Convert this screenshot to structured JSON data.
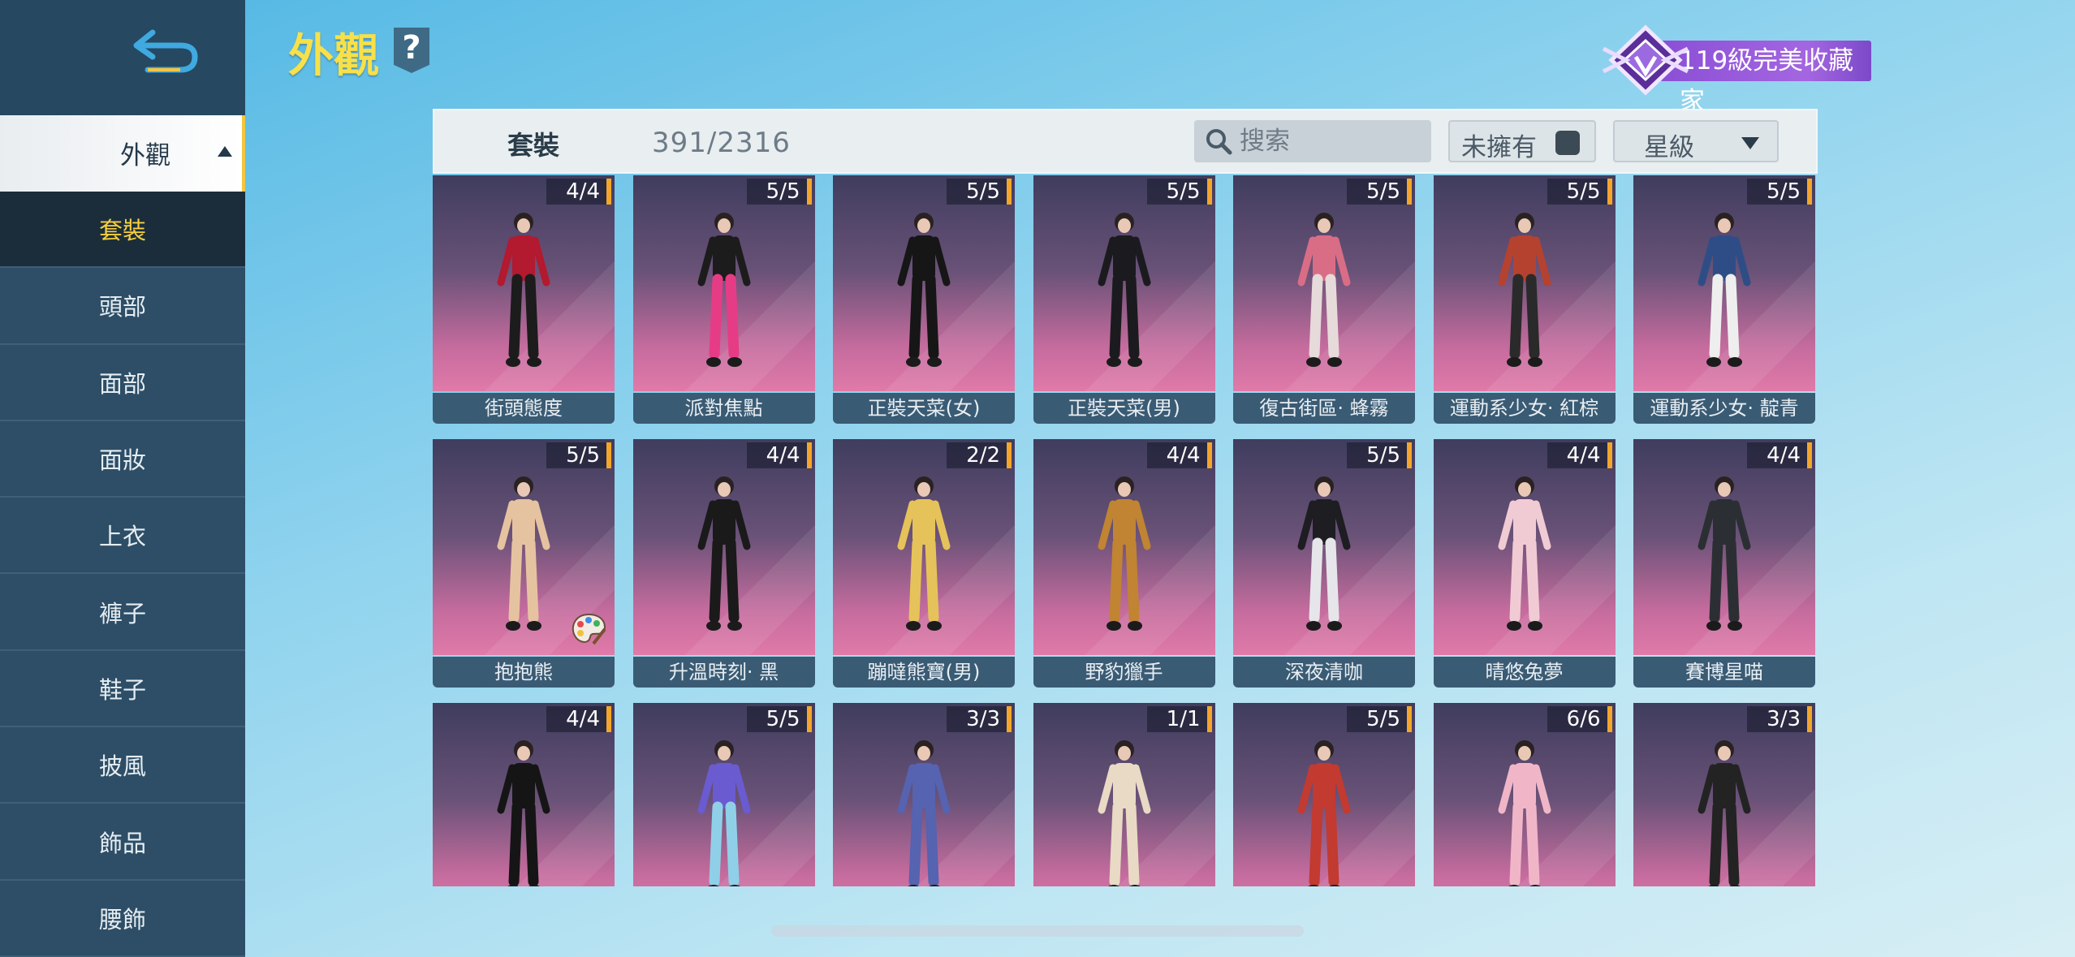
{
  "title": "外觀",
  "help_glyph": "?",
  "rank_badge": "119級完美收藏家",
  "sidebar": {
    "category": "外觀",
    "items": [
      {
        "label": "套裝",
        "active": true
      },
      {
        "label": "頭部"
      },
      {
        "label": "面部"
      },
      {
        "label": "面妝"
      },
      {
        "label": "上衣"
      },
      {
        "label": "褲子"
      },
      {
        "label": "鞋子"
      },
      {
        "label": "披風"
      },
      {
        "label": "飾品"
      },
      {
        "label": "腰飾"
      }
    ]
  },
  "filter_bar": {
    "tab_label": "套裝",
    "count": "391/2316",
    "search_placeholder": "搜索",
    "owned_filter": "未擁有",
    "sort_label": "星級"
  },
  "outfits": [
    {
      "name": "街頭態度",
      "count": "4/4",
      "colors": [
        "#b3192f",
        "#1c1c1c"
      ]
    },
    {
      "name": "派對焦點",
      "count": "5/5",
      "colors": [
        "#1c1c1c",
        "#e63c86"
      ]
    },
    {
      "name": "正裝天菜(女)",
      "count": "5/5",
      "colors": [
        "#161616",
        "#161616"
      ]
    },
    {
      "name": "正裝天菜(男)",
      "count": "5/5",
      "colors": [
        "#1b1b1f",
        "#1b1b1f"
      ]
    },
    {
      "name": "復古街區· 蜂霧",
      "count": "5/5",
      "colors": [
        "#d96d86",
        "#e7dada"
      ]
    },
    {
      "name": "運動系少女· 紅棕",
      "count": "5/5",
      "colors": [
        "#b5422f",
        "#2a2a2a"
      ]
    },
    {
      "name": "運動系少女· 靛青",
      "count": "5/5",
      "colors": [
        "#2e4d86",
        "#eeeeee"
      ]
    },
    {
      "name": "抱抱熊",
      "count": "5/5",
      "colors": [
        "#e6c3a0",
        "#e6c3a0"
      ],
      "palette": true
    },
    {
      "name": "升溫時刻· 黑",
      "count": "4/4",
      "colors": [
        "#1a1a1a",
        "#1a1a1a"
      ]
    },
    {
      "name": "蹦噠熊寶(男)",
      "count": "2/2",
      "colors": [
        "#e5c35a",
        "#e5c35a"
      ]
    },
    {
      "name": "野豹獵手",
      "count": "4/4",
      "colors": [
        "#c08432",
        "#c08432"
      ]
    },
    {
      "name": "深夜清咖",
      "count": "5/5",
      "colors": [
        "#1d1d22",
        "#e6e6ea"
      ]
    },
    {
      "name": "晴悠兔夢",
      "count": "4/4",
      "colors": [
        "#f1cbd4",
        "#f1cbd4"
      ]
    },
    {
      "name": "賽博星喵",
      "count": "4/4",
      "colors": [
        "#2b2f33",
        "#2b2f33"
      ]
    },
    {
      "name": "",
      "count": "4/4",
      "colors": [
        "#151515",
        "#151515"
      ]
    },
    {
      "name": "",
      "count": "5/5",
      "colors": [
        "#6a5bd0",
        "#8fd0e8"
      ]
    },
    {
      "name": "",
      "count": "3/3",
      "colors": [
        "#5563b0",
        "#5563b0"
      ]
    },
    {
      "name": "",
      "count": "1/1",
      "colors": [
        "#e8dac4",
        "#e8dac4"
      ]
    },
    {
      "name": "",
      "count": "5/5",
      "colors": [
        "#c23a30",
        "#c23a30"
      ]
    },
    {
      "name": "",
      "count": "6/6",
      "colors": [
        "#f0b6c8",
        "#f0b6c8"
      ]
    },
    {
      "name": "",
      "count": "3/3",
      "colors": [
        "#232323",
        "#232323"
      ]
    }
  ]
}
